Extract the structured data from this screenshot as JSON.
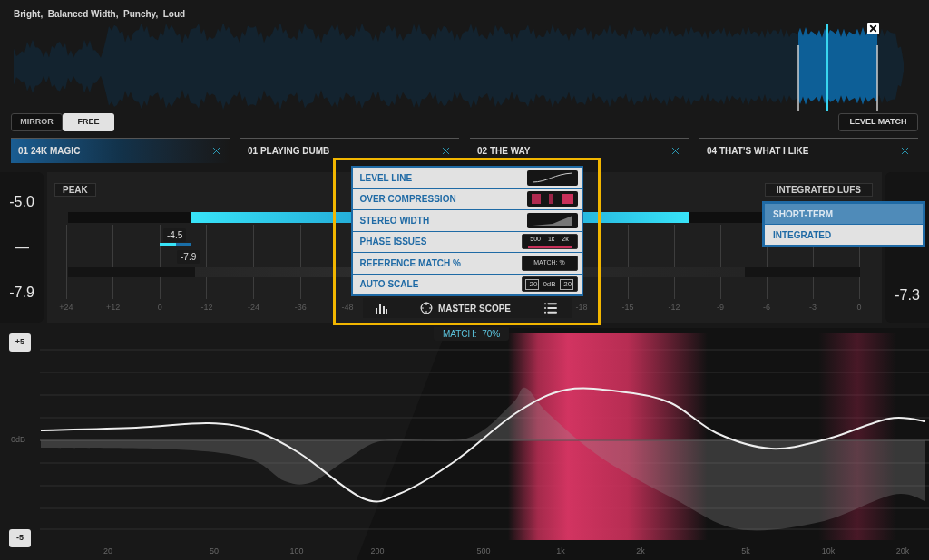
{
  "tags": "Bright,  Balanced Width,  Punchy,  Loud",
  "view_modes": [
    {
      "label": "MIRROR",
      "selected": false
    },
    {
      "label": "FREE",
      "selected": true
    }
  ],
  "level_match": "LEVEL MATCH",
  "tracks": [
    {
      "label": "01 24K MAGIC",
      "selected": true
    },
    {
      "label": "01 PLAYING DUMB",
      "selected": false
    },
    {
      "label": "02 THE WAY",
      "selected": false
    },
    {
      "label": "04 THAT’S WHAT I LIKE",
      "selected": false
    }
  ],
  "meters": {
    "left_readouts": [
      "-5.0",
      "—",
      "-7.9"
    ],
    "right_readouts": [
      "-7.3"
    ],
    "peak_label": "PEAK",
    "lufs_label": "INTEGRATED LUFS",
    "peak_bars": [
      {
        "level": 0.69
      },
      {
        "level": 0.68
      }
    ],
    "lufs_bars": [
      {
        "level": 0.57
      },
      {
        "level": 0.71
      }
    ],
    "markers": [
      "-4.5",
      "-7.9"
    ],
    "peak_scale": [
      "+24",
      "+12",
      "0",
      "-12",
      "-24",
      "-36",
      "-48"
    ],
    "lufs_scale": [
      "-18",
      "-15",
      "-12",
      "-9",
      "-6",
      "-3",
      "0"
    ]
  },
  "lufs_mode_menu": [
    {
      "label": "SHORT-TERM",
      "selected": true
    },
    {
      "label": "INTEGRATED",
      "selected": false
    }
  ],
  "master_scope": {
    "title": "MASTER SCOPE",
    "options": [
      {
        "label": "LEVEL LINE",
        "kind": "level-line"
      },
      {
        "label": "OVER COMPRESSION",
        "kind": "compression"
      },
      {
        "label": "STEREO WIDTH",
        "kind": "width"
      },
      {
        "label": "PHASE ISSUES",
        "kind": "phase",
        "preview_text": [
          "500",
          "1k",
          "2k"
        ]
      },
      {
        "label": "REFERENCE MATCH %",
        "kind": "match",
        "preview_text": [
          "MATCH: %"
        ]
      },
      {
        "label": "AUTO SCALE",
        "kind": "scale",
        "preview_text": [
          "-20",
          "0dB",
          "-20"
        ]
      }
    ]
  },
  "eq": {
    "match": "MATCH:  70%",
    "scale_buttons": [
      "+5",
      "-5"
    ],
    "zero_label": "0dB",
    "frequencies": [
      "20",
      "50",
      "100",
      "200",
      "500",
      "1k",
      "2k",
      "5k",
      "10k",
      "20k"
    ]
  }
}
